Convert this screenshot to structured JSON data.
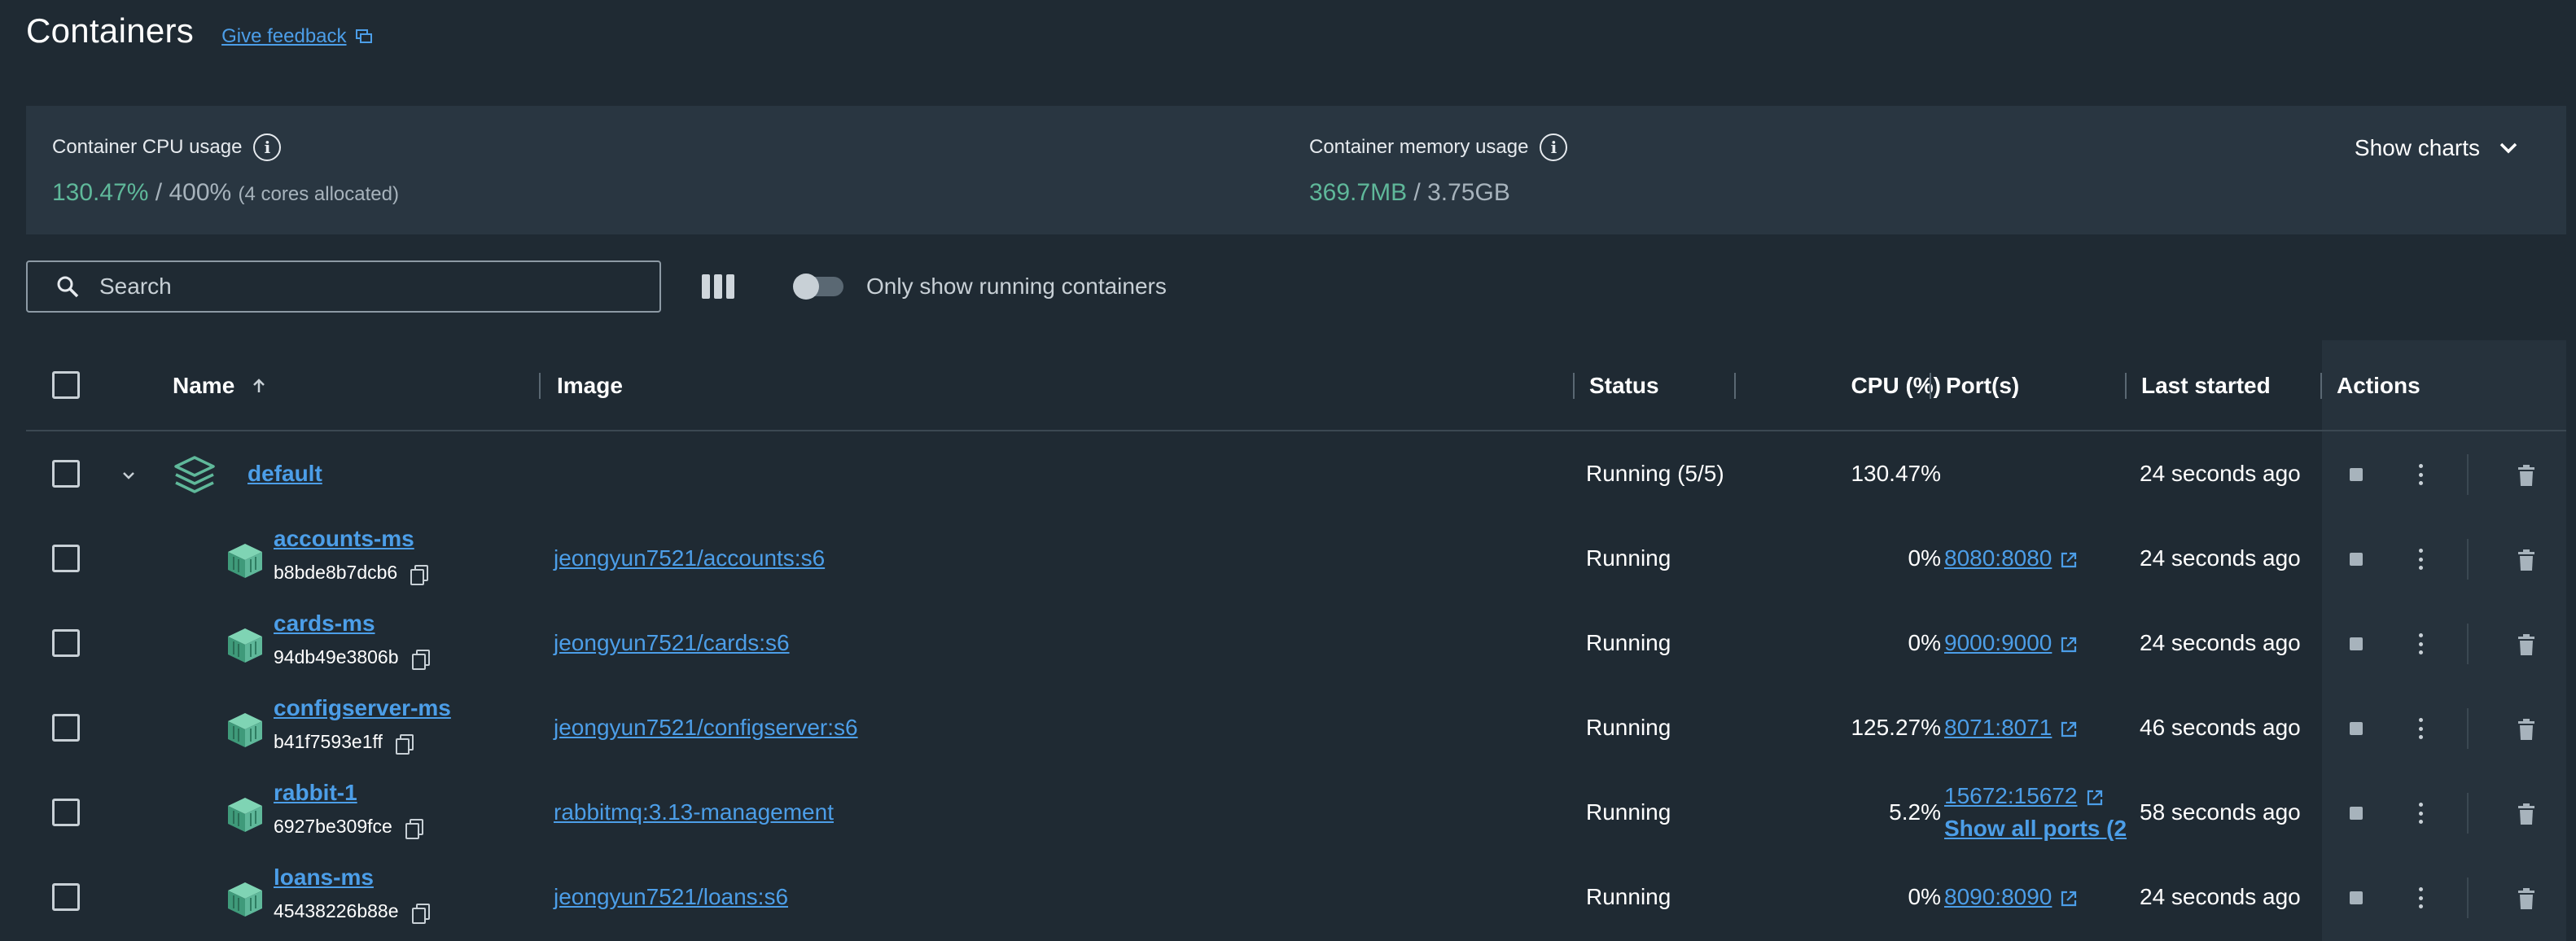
{
  "header": {
    "title": "Containers",
    "feedback": "Give feedback"
  },
  "stats": {
    "cpu_label": "Container CPU usage",
    "cpu_value": "130.47%",
    "cpu_total": "/ 400%",
    "cpu_note": "(4 cores allocated)",
    "mem_label": "Container memory usage",
    "mem_value": "369.7MB",
    "mem_total": "/ 3.75GB",
    "show_charts": "Show charts"
  },
  "toolbar": {
    "search_placeholder": "Search",
    "toggle_label": "Only show running containers"
  },
  "table": {
    "headers": {
      "name": "Name",
      "image": "Image",
      "status": "Status",
      "cpu": "CPU (%)",
      "ports": "Port(s)",
      "last_started": "Last started",
      "actions": "Actions"
    },
    "group": {
      "name": "default",
      "status": "Running (5/5)",
      "cpu": "130.47%",
      "last_started": "24 seconds ago"
    },
    "rows": [
      {
        "name": "accounts-ms",
        "id": "b8bde8b7dcb6",
        "image": "jeongyun7521/accounts:s6",
        "status": "Running",
        "cpu": "0%",
        "port": "8080:8080",
        "extra_ports": "",
        "last_started": "24 seconds ago"
      },
      {
        "name": "cards-ms",
        "id": "94db49e3806b",
        "image": "jeongyun7521/cards:s6",
        "status": "Running",
        "cpu": "0%",
        "port": "9000:9000",
        "extra_ports": "",
        "last_started": "24 seconds ago"
      },
      {
        "name": "configserver-ms",
        "id": "b41f7593e1ff",
        "image": "jeongyun7521/configserver:s6",
        "status": "Running",
        "cpu": "125.27%",
        "port": "8071:8071",
        "extra_ports": "",
        "last_started": "46 seconds ago"
      },
      {
        "name": "rabbit-1",
        "id": "6927be309fce",
        "image": "rabbitmq:3.13-management",
        "status": "Running",
        "cpu": "5.2%",
        "port": "15672:15672",
        "extra_ports": "Show all ports (2",
        "last_started": "58 seconds ago"
      },
      {
        "name": "loans-ms",
        "id": "45438226b88e",
        "image": "jeongyun7521/loans:s6",
        "status": "Running",
        "cpu": "0%",
        "port": "8090:8090",
        "extra_ports": "",
        "last_started": "24 seconds ago"
      }
    ]
  },
  "colors": {
    "background": "#1f2a33",
    "panel": "#293641",
    "accent_link": "#4c9ee8",
    "green": "#5fb89a"
  }
}
